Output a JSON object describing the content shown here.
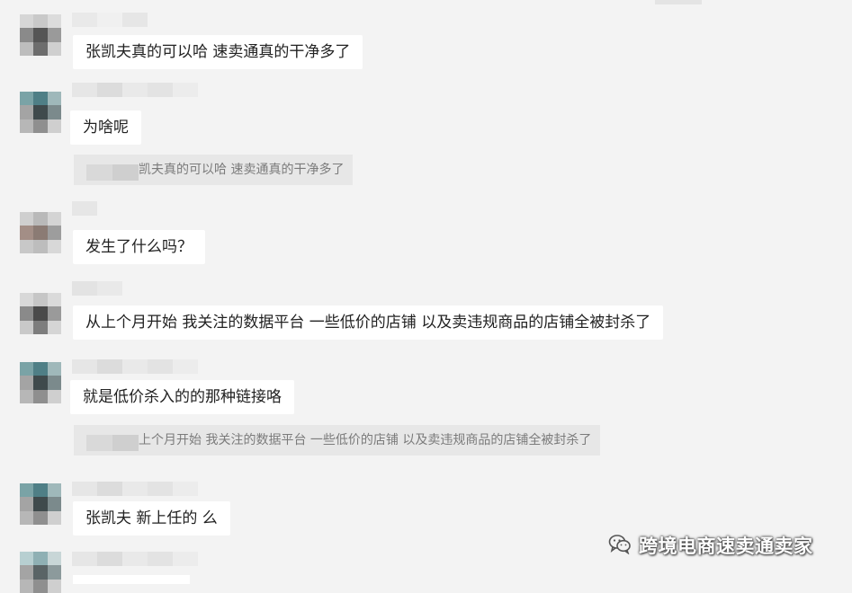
{
  "messages": [
    {
      "text": "张凯夫真的可以哈 速卖通真的干净多了"
    },
    {
      "text": "为啥呢",
      "quote": "凯夫真的可以哈 速卖通真的干净多了"
    },
    {
      "text": "发生了什么吗？"
    },
    {
      "text": "从上个月开始 我关注的数据平台 一些低价的店铺 以及卖违规商品的店铺全被封杀了"
    },
    {
      "text": "就是低价杀入的的那种链接咯",
      "quote": "上个月开始 我关注的数据平台 一些低价的店铺 以及卖违规商品的店铺全被封杀了"
    },
    {
      "text": "张凯夫  新上任的 么"
    }
  ],
  "watermark": {
    "text": "跨境电商速卖通卖家",
    "icon": "wechat-icon"
  },
  "colors": {
    "background": "#f3f3f3",
    "bubble": "#ffffff",
    "quote_bg": "#e7e7e7"
  }
}
